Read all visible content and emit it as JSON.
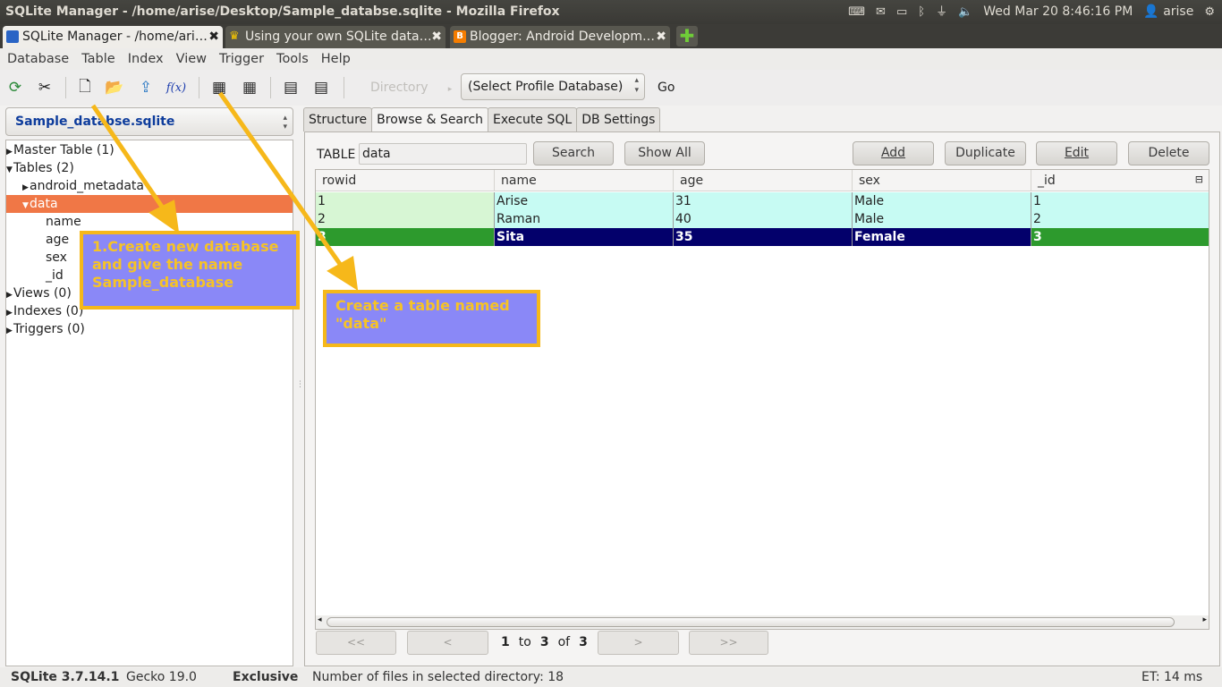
{
  "window": {
    "title": "SQLite Manager - /home/arise/Desktop/Sample_databse.sqlite - Mozilla Firefox"
  },
  "system": {
    "datetime": "Wed Mar 20  8:46:16 PM",
    "user": "arise"
  },
  "browser_tabs": [
    {
      "label": "SQLite Manager - /home/ari…",
      "icon": "database-icon"
    },
    {
      "label": "Using your own SQLite data…",
      "icon": "crown-icon"
    },
    {
      "label": "Blogger: Android Developm…",
      "icon": "blogger-icon"
    }
  ],
  "menu": [
    "Database",
    "Table",
    "Index",
    "View",
    "Trigger",
    "Tools",
    "Help"
  ],
  "toolbar": {
    "directory_label": "Directory",
    "profile_select": "(Select Profile Database)",
    "go_label": "Go"
  },
  "left": {
    "db_select": "Sample_databse.sqlite",
    "tree": [
      "Master Table (1)",
      "Tables (2)",
      "android_metadata",
      "data",
      "name",
      "age",
      "sex",
      "_id",
      "Views (0)",
      "Indexes (0)",
      "Triggers (0)"
    ]
  },
  "tabs": [
    "Structure",
    "Browse & Search",
    "Execute SQL",
    "DB Settings"
  ],
  "browse": {
    "table_label": "TABLE",
    "table_value": "data",
    "search_label": "Search",
    "showall_label": "Show All",
    "add_label": "Add",
    "duplicate_label": "Duplicate",
    "edit_label": "Edit",
    "delete_label": "Delete",
    "columns": [
      "rowid",
      "name",
      "age",
      "sex",
      "_id"
    ],
    "rows": [
      [
        "1",
        "Arise",
        "31",
        "Male",
        "1"
      ],
      [
        "2",
        "Raman",
        "40",
        "Male",
        "2"
      ],
      [
        "3",
        "Sita",
        "35",
        "Female",
        "3"
      ]
    ],
    "selected_row_index": 2
  },
  "pager": {
    "first": "<<",
    "prev": "<",
    "next": ">",
    "last": ">>",
    "current": "1",
    "to_label": "to",
    "to": "3",
    "of_label": "of",
    "total": "3"
  },
  "status": {
    "sqlite": "SQLite 3.7.14.1",
    "gecko": "Gecko 19.0",
    "mode": "Exclusive",
    "files": "Number of files in selected directory: 18",
    "et": "ET: 14 ms"
  },
  "annotations": {
    "callout1": "1.Create new database and give the name Sample_database",
    "callout2": "Create a table named \"data\""
  },
  "colors": {
    "selection": "#f07746",
    "row_even": "#c7fbf3",
    "selected_row": "#03006b",
    "callout_bg": "#8a88f7",
    "callout_border": "#f6b81a"
  }
}
